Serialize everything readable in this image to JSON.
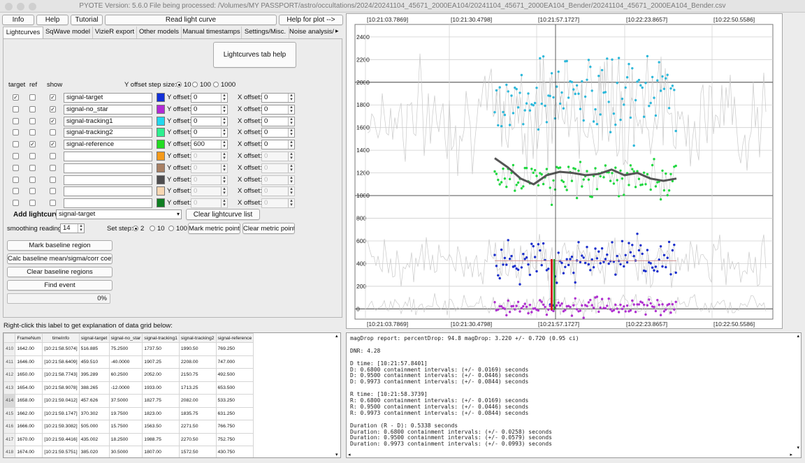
{
  "window": {
    "title": "PYOTE Version: 5.6.0  File being processed: /Volumes/MY PASSPORT/astro/occultations/2024/20241104_45671_2000EA104/20241104_45671_2000EA104_Bender/20241104_45671_2000EA104_Bender.csv"
  },
  "toolbar": {
    "info": "Info",
    "help": "Help",
    "tutorial": "Tutorial",
    "read_lightcurve": "Read light curve",
    "help_for_plot": "Help for plot -->"
  },
  "tabs": [
    "Lightcurves",
    "SqWave model",
    "VizieR export",
    "Other models",
    "Manual timestamps",
    "Settings/Misc.",
    "Noise analysis/"
  ],
  "tab_scroll_icon": "chevron-right-icon",
  "lightcurves": {
    "help_button": "Lightcurves tab help",
    "col_target": "target",
    "col_ref": "ref",
    "col_show": "show",
    "yoffset_step_label": "Y offset step size:",
    "yoffset_steps": [
      "10",
      "100",
      "1000"
    ],
    "yoffset_selected": "10",
    "y_offset_label": "Y offset:",
    "x_offset_label": "X offset:",
    "rows": [
      {
        "name": "signal-target",
        "color": "#1230d8",
        "target": true,
        "ref": false,
        "show": true,
        "yoffset": "0",
        "xoffset": "0",
        "enabled": true
      },
      {
        "name": "signal-no_star",
        "color": "#b22ad6",
        "target": false,
        "ref": false,
        "show": true,
        "yoffset": "0",
        "xoffset": "0",
        "enabled": true
      },
      {
        "name": "signal-tracking1",
        "color": "#22d7ee",
        "target": false,
        "ref": false,
        "show": true,
        "yoffset": "0",
        "xoffset": "0",
        "enabled": true
      },
      {
        "name": "signal-tracking2",
        "color": "#2cf090",
        "target": false,
        "ref": false,
        "show": false,
        "yoffset": "0",
        "xoffset": "0",
        "enabled": true
      },
      {
        "name": "signal-reference",
        "color": "#23dc22",
        "target": false,
        "ref": true,
        "show": true,
        "yoffset": "600",
        "xoffset": "0",
        "enabled": true
      },
      {
        "name": "",
        "color": "#f59a1a",
        "target": false,
        "ref": false,
        "show": false,
        "yoffset": "0",
        "xoffset": "0",
        "enabled": false
      },
      {
        "name": "",
        "color": "#a88064",
        "target": false,
        "ref": false,
        "show": false,
        "yoffset": "0",
        "xoffset": "0",
        "enabled": false
      },
      {
        "name": "",
        "color": "#4e4d4f",
        "target": false,
        "ref": false,
        "show": false,
        "yoffset": "0",
        "xoffset": "0",
        "enabled": false
      },
      {
        "name": "",
        "color": "#f7d7b2",
        "target": false,
        "ref": false,
        "show": false,
        "yoffset": "0",
        "xoffset": "0",
        "enabled": false
      },
      {
        "name": "",
        "color": "#0f7e22",
        "target": false,
        "ref": false,
        "show": false,
        "yoffset": "0",
        "xoffset": "0",
        "enabled": false
      }
    ],
    "add_lightcurve_label": "Add lightcurve",
    "add_lightcurve_value": "signal-target",
    "clear_lightcurve_list": "Clear lightcurve list",
    "smoothing_label": "smoothing readings",
    "smoothing_value": "14",
    "set_step_label": "Set step:",
    "set_steps": [
      "2",
      "10",
      "100"
    ],
    "set_step_selected": "2",
    "mark_metric_points": "Mark metric points",
    "clear_metric_points": "Clear metric points",
    "mark_baseline_region": "Mark baseline region",
    "calc_baseline": "Calc baseline mean/sigma/corr coeffs",
    "clear_baseline_regions": "Clear baseline regions",
    "find_event": "Find event",
    "progress_value": 0,
    "progress_text": "0%"
  },
  "grid_hint": "Right-click this label to get explanation of data grid below:",
  "data_grid": {
    "columns": [
      "FrameNum",
      "timeInfo",
      "signal-target",
      "signal-no_star",
      "signal-tracking1",
      "signal-tracking2",
      "signal-reference"
    ],
    "rows": [
      {
        "idx": "410",
        "cells": [
          "1642.00",
          "[10:21:58.5074]",
          "516.885",
          "75.2500",
          "1737.50",
          "1990.50",
          "769.250"
        ]
      },
      {
        "idx": "411",
        "cells": [
          "1646.00",
          "[10:21:58.6409]",
          "459.510",
          "-40.0000",
          "1907.25",
          "2208.00",
          "747.000"
        ]
      },
      {
        "idx": "412",
        "cells": [
          "1650.00",
          "[10:21:58.7743]",
          "395.289",
          "60.2500",
          "2052.00",
          "2150.75",
          "492.500"
        ]
      },
      {
        "idx": "413",
        "cells": [
          "1654.00",
          "[10:21:58.9078]",
          "388.265",
          "-12.0000",
          "1933.00",
          "1713.25",
          "653.500"
        ]
      },
      {
        "idx": "414",
        "cells": [
          "1658.00",
          "[10:21:59.0412]",
          "457.626",
          "37.5000",
          "1827.75",
          "2082.00",
          "533.250"
        ],
        "selected": true
      },
      {
        "idx": "415",
        "cells": [
          "1662.00",
          "[10:21:59.1747]",
          "370.302",
          "19.7500",
          "1823.00",
          "1835.75",
          "631.250"
        ]
      },
      {
        "idx": "416",
        "cells": [
          "1666.00",
          "[10:21:59.3082]",
          "505.000",
          "15.7500",
          "1563.50",
          "2271.50",
          "766.750"
        ]
      },
      {
        "idx": "417",
        "cells": [
          "1670.00",
          "[10:21:59.4416]",
          "435.002",
          "18.2500",
          "1988.75",
          "2270.50",
          "752.750"
        ]
      },
      {
        "idx": "418",
        "cells": [
          "1674.00",
          "[10:21:59.5751]",
          "385.020",
          "30.5000",
          "1807.00",
          "1572.50",
          "430.750"
        ]
      }
    ]
  },
  "report_lines": [
    "magDrop report: percentDrop: 94.8 magDrop: 3.220 +/- 0.720 (0.95 ci)",
    "",
    "DNR: 4.28",
    "",
    "D time: [10:21:57.8401]",
    "D: 0.6800 containment intervals: (+/- 0.0169) seconds",
    "D: 0.9500 containment intervals: (+/- 0.0446) seconds",
    "D: 0.9973 containment intervals: (+/- 0.0844) seconds",
    "",
    "R time: [10:21:58.3739]",
    "R: 0.6800 containment intervals: (+/- 0.0169) seconds",
    "R: 0.9500 containment intervals: (+/- 0.0446) seconds",
    "R: 0.9973 containment intervals: (+/- 0.0844) seconds",
    "",
    "Duration (R - D): 0.5338 seconds",
    "Duration: 0.6800 containment intervals: (+/- 0.0258) seconds",
    "Duration: 0.9500 containment intervals: (+/- 0.0579) seconds",
    "Duration: 0.9973 containment intervals: (+/- 0.0993) seconds"
  ],
  "chart_data": {
    "type": "scatter",
    "title": "",
    "xlabel": "",
    "ylabel": "",
    "x_ticks": [
      "[10:21:03.7869]",
      "[10:21:30.4798]",
      "[10:21:57.1727]",
      "[10:22:23.8657]",
      "[10:22:50.5586]"
    ],
    "y_ticks": [
      0,
      200,
      400,
      600,
      800,
      1000,
      1200,
      1400,
      1600,
      1800,
      2000,
      2200,
      2400
    ],
    "ylim": [
      -90,
      2510
    ],
    "grid": true,
    "cursor_x_label": "[10:21:57.1727]",
    "series": [
      {
        "name": "signal-tracking1",
        "color": "#2cb8da",
        "mean": 1900,
        "spread": 220
      },
      {
        "name": "signal-reference",
        "color": "#20d840",
        "mean": 1150,
        "spread": 110
      },
      {
        "name": "signal-target",
        "color": "#1a2ecc",
        "mean": 430,
        "spread": 110
      },
      {
        "name": "signal-no_star",
        "color": "#b030d0",
        "mean": 20,
        "spread": 45
      }
    ],
    "smoothed_reference": {
      "color": "#555555",
      "values": [
        1330,
        1250,
        1150,
        1100,
        1180,
        1210,
        1200,
        1180,
        1190,
        1230,
        1180,
        1200,
        1150,
        1130,
        1150
      ]
    },
    "baseline_level": 425,
    "event_markers": {
      "d_time": "[10:21:57.8401]",
      "r_time": "[10:21:58.3739]",
      "colors": [
        "#d02020",
        "#20a020"
      ]
    }
  }
}
